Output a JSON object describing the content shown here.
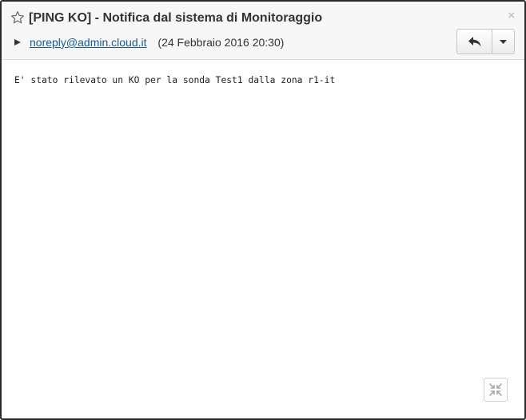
{
  "message": {
    "subject": "[PING KO] - Notifica dal sistema di Monitoraggio",
    "sender_email": "noreply@admin.cloud.it",
    "date": "(24 Febbraio 2016 20:30)",
    "body": "E' stato rilevato un KO per la sonda Test1 dalla zona r1-it"
  },
  "icons": {
    "star": "star-outline-icon",
    "close": "close-icon",
    "expand": "triangle-right-icon",
    "reply": "reply-icon",
    "more": "caret-down-icon",
    "fullscreen": "fullscreen-compress-icon"
  },
  "glyphs": {
    "close": "×"
  },
  "colors": {
    "link": "#1a5a95",
    "header_bg": "#f7f7f7",
    "border": "#2b2b2b"
  }
}
